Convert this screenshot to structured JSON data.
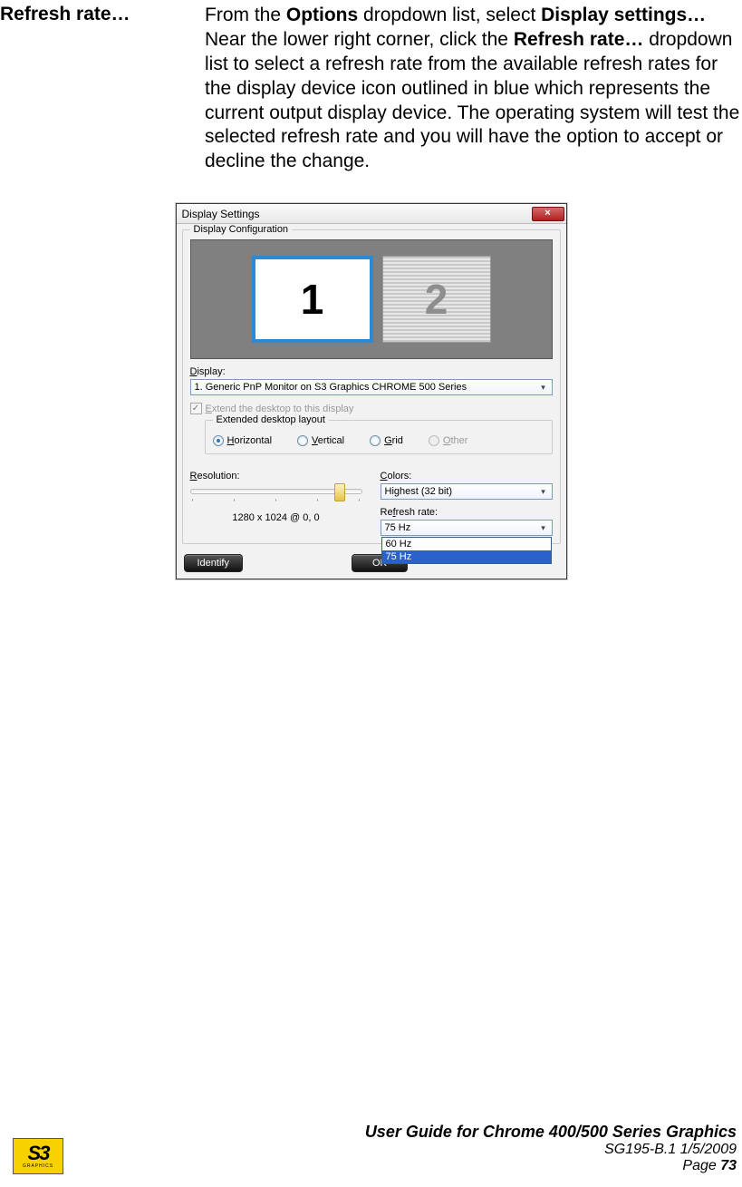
{
  "term": "Refresh rate…",
  "desc": {
    "p1a": "From the ",
    "p1b": "Options",
    "p1c": " dropdown list, select ",
    "p1d": "Display settings…",
    "p1e": " Near the lower right corner, click the ",
    "p1f": "Refresh rate…",
    "p1g": " dropdown list to select a refresh rate from the available refresh rates for the display device icon outlined in blue which represents the current output display device. The operating system will test the selected refresh rate and you will have the option to accept or decline the change."
  },
  "dialog": {
    "title": "Display Settings",
    "close": "×",
    "group_title": "Display Configuration",
    "monitor1": "1",
    "monitor2": "2",
    "display_label_pre": "D",
    "display_label_post": "isplay:",
    "display_value": "1. Generic PnP Monitor on S3 Graphics CHROME 500 Series",
    "extend_check_pre": "E",
    "extend_check_post": "xtend the desktop to this display",
    "layout_group": "Extended desktop layout",
    "radios": {
      "horiz_u": "H",
      "horiz": "orizontal",
      "vert_u": "V",
      "vert": "ertical",
      "grid_u": "G",
      "grid": "rid",
      "other_u": "O",
      "other": "ther"
    },
    "resolution_label_pre": "R",
    "resolution_label_post": "esolution:",
    "resolution_value": "1280 x 1024 @ 0, 0",
    "colors_label_pre": "C",
    "colors_label_post": "olors:",
    "colors_value": "Highest (32 bit)",
    "refresh_label_pre": "Re",
    "refresh_label_u": "f",
    "refresh_label_post": "resh rate:",
    "refresh_value": "75 Hz",
    "refresh_options": {
      "o1": "60 Hz",
      "o2": "75 Hz"
    },
    "identify": "Identify",
    "ok": "OK"
  },
  "footer": {
    "logo": "S3",
    "logo_sub": "GRAPHICS",
    "l1": "User Guide for Chrome 400/500 Series Graphics",
    "l2": "SG195-B.1   1/5/2009",
    "l3a": "Page ",
    "l3b": "73"
  }
}
